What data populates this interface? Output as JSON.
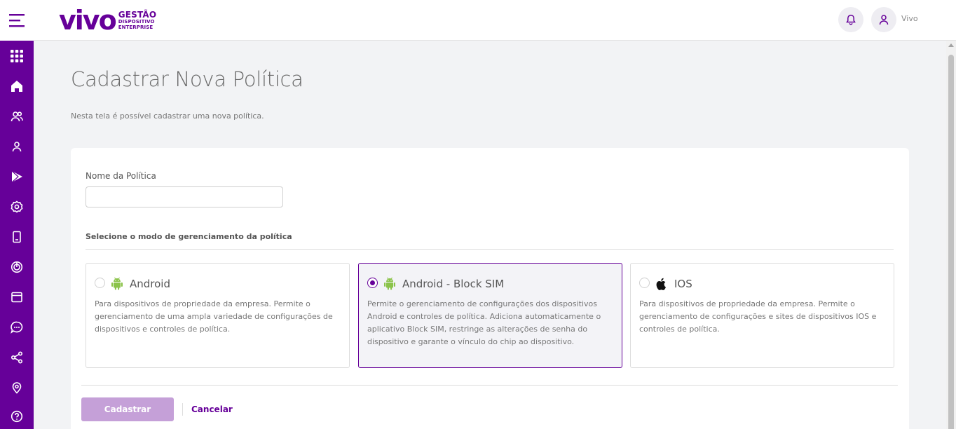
{
  "header": {
    "logo_text": "vivo",
    "logo_sub": [
      "GESTÃO",
      "DISPOSITIVO",
      "ENTERPRISE"
    ],
    "user_name": "Vivo"
  },
  "sidebar": {
    "icons": [
      "apps-grid-icon",
      "home-icon",
      "users-icon",
      "user-icon",
      "play-store-icon",
      "settings-icon",
      "device-icon",
      "target-icon",
      "calendar-icon",
      "chat-icon",
      "share-icon",
      "location-icon",
      "help-icon"
    ]
  },
  "page": {
    "title": "Cadastrar Nova Política",
    "description": "Nesta tela é possível cadastrar uma nova política."
  },
  "form": {
    "name_label": "Nome da Política",
    "name_value": "",
    "section_label": "Selecione o modo de gerenciamento da política",
    "options": [
      {
        "title": "Android",
        "description": "Para dispositivos de propriedade da empresa. Permite o gerenciamento de uma ampla variedade de configurações de dispositivos e controles de política.",
        "selected": false,
        "icon": "android-icon"
      },
      {
        "title": "Android - Block SIM",
        "description": "Permite o gerenciamento de configurações dos dispositivos Android e controles de política. Adiciona automaticamente o aplicativo Block SIM, restringe as alterações de senha do dispositivo e garante o vínculo do chip ao dispositivo.",
        "selected": true,
        "icon": "android-icon"
      },
      {
        "title": "IOS",
        "description": "Para dispositivos de propriedade da empresa. Permite o gerenciamento de configurações e sites de dispositivos IOS e controles de política.",
        "selected": false,
        "icon": "apple-icon"
      }
    ],
    "submit_label": "Cadastrar",
    "cancel_label": "Cancelar"
  },
  "colors": {
    "brand": "#660099",
    "android": "#8bc34a",
    "submit_disabled": "#c5a0d8"
  }
}
